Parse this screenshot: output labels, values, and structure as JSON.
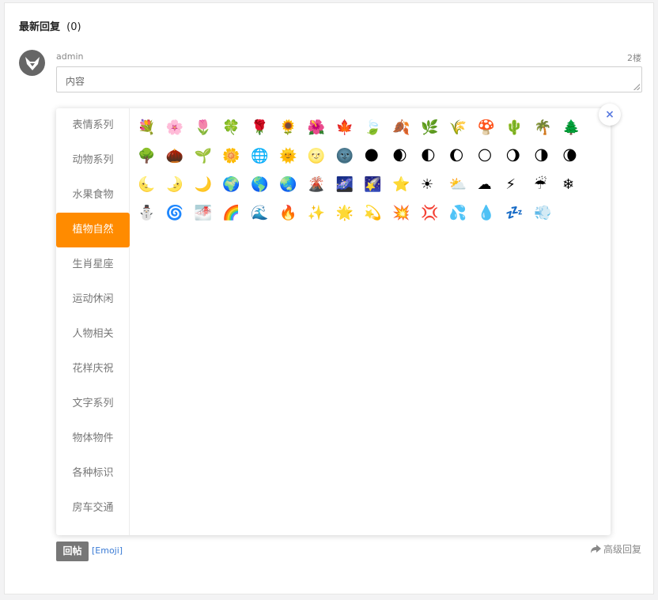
{
  "header": {
    "title": "最新回复",
    "count": "(0)"
  },
  "comment": {
    "username": "admin",
    "floor": "2楼",
    "textarea_value": "内容"
  },
  "emoji_panel": {
    "categories": [
      {
        "label": "表情系列"
      },
      {
        "label": "动物系列"
      },
      {
        "label": "水果食物"
      },
      {
        "label": "植物自然",
        "active": true
      },
      {
        "label": "生肖星座"
      },
      {
        "label": "运动休闲"
      },
      {
        "label": "人物相关"
      },
      {
        "label": "花样庆祝"
      },
      {
        "label": "文字系列"
      },
      {
        "label": "物体物件"
      },
      {
        "label": "各种标识"
      },
      {
        "label": "房车交通"
      }
    ],
    "active_color": "#ff8b00",
    "emojis": [
      "💐",
      "🌸",
      "🌷",
      "🍀",
      "🌹",
      "🌻",
      "🌺",
      "🍁",
      "🍃",
      "🍂",
      "🌿",
      "🌾",
      "🍄",
      "🌵",
      "🌴",
      "🌲",
      "🌳",
      "🌰",
      "🌱",
      "🌼",
      "🌐",
      "🌞",
      "🌝",
      "🌚",
      "🌑",
      "🌒",
      "🌓",
      "🌔",
      "🌕",
      "🌖",
      "🌗",
      "🌘",
      "🌜",
      "🌛",
      "🌙",
      "🌍",
      "🌎",
      "🌏",
      "🌋",
      "🌌",
      "🌠",
      "⭐",
      "☀",
      "⛅",
      "☁",
      "⚡",
      "☔",
      "❄",
      "⛄",
      "🌀",
      "🌁",
      "🌈",
      "🌊",
      "🔥",
      "✨",
      "🌟",
      "💫",
      "💥",
      "💢",
      "💦",
      "💧",
      "💤",
      "💨"
    ],
    "close_label": "×"
  },
  "footer": {
    "reply_label": "回帖",
    "emoji_link": "[Emoji]",
    "advanced_reply": "高级回复"
  }
}
